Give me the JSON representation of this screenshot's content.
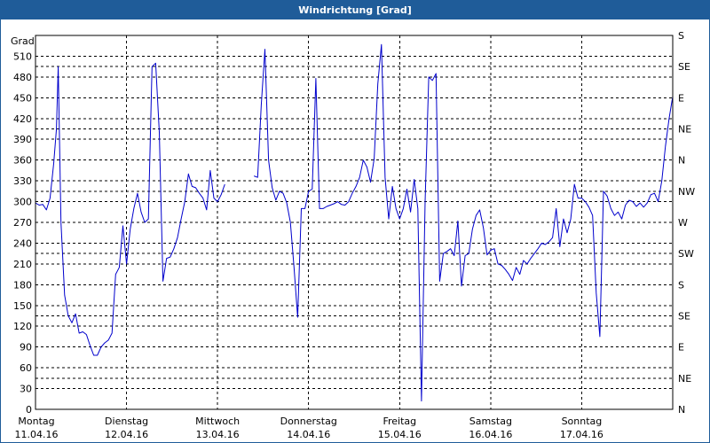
{
  "window": {
    "title": "Windrichtung [Grad]"
  },
  "chart_data": {
    "type": "line",
    "title": "Windrichtung [Grad]",
    "ylabel": "Grad",
    "ylim": [
      0,
      540
    ],
    "yticks": [
      0,
      30,
      60,
      90,
      120,
      150,
      180,
      210,
      240,
      270,
      300,
      330,
      360,
      390,
      420,
      450,
      480,
      510
    ],
    "right_axis_labels": [
      "N",
      "NE",
      "E",
      "SE",
      "S",
      "SW",
      "W",
      "NW",
      "N",
      "NE",
      "E",
      "SE",
      "S"
    ],
    "xlim": [
      0,
      7
    ],
    "x_unit": "days since 11.04.16 00:00",
    "grid": true,
    "line_color": "#0000cc",
    "days": [
      {
        "weekday": "Montag",
        "date": "11.04.16"
      },
      {
        "weekday": "Dienstag",
        "date": "12.04.16"
      },
      {
        "weekday": "Mittwoch",
        "date": "13.04.16"
      },
      {
        "weekday": "Donnerstag",
        "date": "14.04.16"
      },
      {
        "weekday": "Freitag",
        "date": "15.04.16"
      },
      {
        "weekday": "Samstag",
        "date": "16.04.16"
      },
      {
        "weekday": "Sonntag",
        "date": "17.04.16"
      }
    ],
    "series": [
      {
        "name": "",
        "points": [
          [
            0.0,
            298
          ],
          [
            0.04,
            295
          ],
          [
            0.08,
            296
          ],
          [
            0.12,
            288
          ],
          [
            0.16,
            305
          ],
          [
            0.2,
            355
          ],
          [
            0.23,
            405
          ],
          [
            0.25,
            495
          ],
          [
            0.28,
            270
          ],
          [
            0.32,
            165
          ],
          [
            0.36,
            135
          ],
          [
            0.4,
            125
          ],
          [
            0.44,
            138
          ],
          [
            0.48,
            110
          ],
          [
            0.52,
            112
          ],
          [
            0.56,
            108
          ],
          [
            0.6,
            92
          ],
          [
            0.64,
            78
          ],
          [
            0.68,
            78
          ],
          [
            0.72,
            90
          ],
          [
            0.76,
            96
          ],
          [
            0.8,
            100
          ],
          [
            0.84,
            110
          ],
          [
            0.88,
            195
          ],
          [
            0.92,
            205
          ],
          [
            0.96,
            265
          ],
          [
            1.0,
            210
          ],
          [
            1.04,
            260
          ],
          [
            1.08,
            290
          ],
          [
            1.12,
            312
          ],
          [
            1.16,
            285
          ],
          [
            1.2,
            270
          ],
          [
            1.24,
            275
          ],
          [
            1.28,
            495
          ],
          [
            1.32,
            500
          ],
          [
            1.36,
            400
          ],
          [
            1.4,
            185
          ],
          [
            1.44,
            218
          ],
          [
            1.48,
            220
          ],
          [
            1.52,
            232
          ],
          [
            1.56,
            248
          ],
          [
            1.6,
            275
          ],
          [
            1.64,
            300
          ],
          [
            1.68,
            340
          ],
          [
            1.72,
            322
          ],
          [
            1.76,
            320
          ],
          [
            1.8,
            312
          ],
          [
            1.84,
            305
          ],
          [
            1.88,
            288
          ],
          [
            1.92,
            345
          ],
          [
            1.96,
            305
          ],
          [
            2.0,
            300
          ],
          [
            2.04,
            310
          ],
          [
            2.08,
            325
          ],
          null,
          [
            2.4,
            337
          ],
          [
            2.44,
            335
          ],
          [
            2.48,
            440
          ],
          [
            2.52,
            520
          ],
          [
            2.56,
            360
          ],
          [
            2.6,
            320
          ],
          [
            2.64,
            302
          ],
          [
            2.68,
            315
          ],
          [
            2.72,
            312
          ],
          [
            2.76,
            298
          ],
          [
            2.8,
            270
          ],
          [
            2.84,
            205
          ],
          [
            2.88,
            133
          ],
          [
            2.92,
            290
          ],
          [
            2.96,
            290
          ],
          [
            3.0,
            315
          ],
          [
            3.04,
            318
          ],
          [
            3.08,
            478
          ],
          [
            3.12,
            290
          ],
          [
            3.16,
            290
          ],
          [
            3.2,
            293
          ],
          [
            3.24,
            295
          ],
          [
            3.28,
            297
          ],
          [
            3.32,
            300
          ],
          [
            3.36,
            296
          ],
          [
            3.4,
            295
          ],
          [
            3.44,
            300
          ],
          [
            3.48,
            312
          ],
          [
            3.52,
            322
          ],
          [
            3.56,
            335
          ],
          [
            3.6,
            360
          ],
          [
            3.64,
            350
          ],
          [
            3.68,
            328
          ],
          [
            3.72,
            362
          ],
          [
            3.76,
            470
          ],
          [
            3.8,
            527
          ],
          [
            3.84,
            335
          ],
          [
            3.88,
            275
          ],
          [
            3.92,
            322
          ],
          [
            3.96,
            290
          ],
          [
            4.0,
            275
          ],
          [
            4.04,
            290
          ],
          [
            4.08,
            318
          ],
          [
            4.12,
            285
          ],
          [
            4.16,
            332
          ],
          [
            4.2,
            290
          ],
          [
            4.24,
            12
          ],
          [
            4.28,
            300
          ],
          [
            4.32,
            480
          ],
          [
            4.36,
            475
          ],
          [
            4.4,
            485
          ],
          [
            4.44,
            185
          ],
          [
            4.48,
            225
          ],
          [
            4.52,
            228
          ],
          [
            4.56,
            232
          ],
          [
            4.6,
            222
          ],
          [
            4.64,
            272
          ],
          [
            4.68,
            178
          ],
          [
            4.72,
            222
          ],
          [
            4.76,
            225
          ],
          [
            4.8,
            260
          ],
          [
            4.84,
            280
          ],
          [
            4.88,
            288
          ],
          [
            4.92,
            262
          ],
          [
            4.96,
            223
          ],
          [
            5.0,
            230
          ],
          [
            5.04,
            232
          ],
          [
            5.08,
            210
          ],
          [
            5.12,
            208
          ],
          [
            5.16,
            202
          ],
          [
            5.2,
            195
          ],
          [
            5.24,
            186
          ],
          [
            5.28,
            205
          ],
          [
            5.32,
            195
          ],
          [
            5.36,
            215
          ],
          [
            5.4,
            210
          ],
          [
            5.44,
            218
          ],
          [
            5.48,
            225
          ],
          [
            5.52,
            232
          ],
          [
            5.56,
            240
          ],
          [
            5.6,
            238
          ],
          [
            5.64,
            242
          ],
          [
            5.68,
            248
          ],
          [
            5.72,
            290
          ],
          [
            5.76,
            235
          ],
          [
            5.8,
            275
          ],
          [
            5.84,
            255
          ],
          [
            5.88,
            275
          ],
          [
            5.92,
            325
          ],
          [
            5.96,
            305
          ],
          [
            6.0,
            305
          ],
          [
            6.04,
            300
          ],
          [
            6.08,
            292
          ],
          [
            6.12,
            280
          ],
          [
            6.16,
            168
          ],
          [
            6.2,
            105
          ],
          [
            6.24,
            315
          ],
          [
            6.28,
            308
          ],
          [
            6.32,
            290
          ],
          [
            6.36,
            280
          ],
          [
            6.4,
            285
          ],
          [
            6.44,
            275
          ],
          [
            6.48,
            295
          ],
          [
            6.52,
            302
          ],
          [
            6.56,
            300
          ],
          [
            6.6,
            293
          ],
          [
            6.64,
            298
          ],
          [
            6.68,
            292
          ],
          [
            6.72,
            298
          ],
          [
            6.76,
            310
          ],
          [
            6.8,
            312
          ],
          [
            6.84,
            300
          ],
          [
            6.88,
            330
          ],
          [
            6.92,
            380
          ],
          [
            6.96,
            420
          ],
          [
            7.0,
            452
          ]
        ]
      }
    ]
  }
}
